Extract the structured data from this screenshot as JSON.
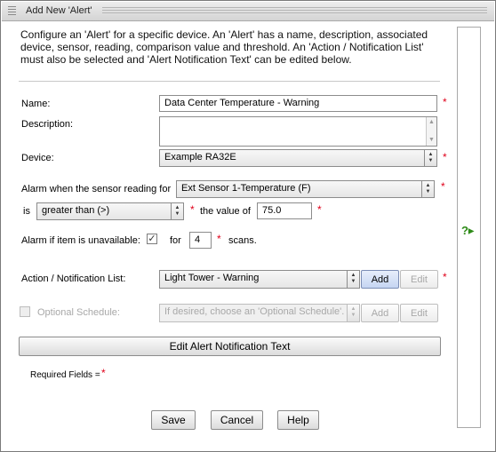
{
  "window": {
    "title": "Add New 'Alert'"
  },
  "intro_text": "Configure an 'Alert' for a specific device. An 'Alert' has a name, description, associated device, sensor, reading, comparison value and threshold. An 'Action / Notification List' must also be selected and 'Alert Notification Text' can be edited below.",
  "required_marker": "*",
  "form": {
    "name": {
      "label": "Name:",
      "value": "Data Center Temperature - Warning"
    },
    "description": {
      "label": "Description:",
      "value": ""
    },
    "device": {
      "label": "Device:",
      "value": "Example RA32E"
    },
    "alarm": {
      "label": "Alarm when the sensor reading for",
      "sensor_value": "Ext Sensor 1-Temperature (F)",
      "is_label": "is",
      "comparison_value": "greater than (>)",
      "value_of_label": "the value of",
      "threshold_value": "75.0"
    },
    "unavailable": {
      "label": "Alarm if item is unavailable:",
      "checked": true,
      "for_label": "for",
      "scans_value": "4",
      "scans_label": "scans."
    },
    "action_list": {
      "label": "Action / Notification List:",
      "value": "Light Tower - Warning",
      "add_label": "Add",
      "edit_label": "Edit"
    },
    "schedule": {
      "label": "Optional Schedule:",
      "checked": false,
      "placeholder": "If desired, choose an 'Optional Schedule'.",
      "add_label": "Add",
      "edit_label": "Edit"
    },
    "edit_notification_label": "Edit Alert Notification Text",
    "required_fields_label": "Required Fields ="
  },
  "buttons": {
    "save": "Save",
    "cancel": "Cancel",
    "help": "Help"
  },
  "help_icon": {
    "name": "help-question-icon",
    "symbol": "?"
  },
  "colors": {
    "required": "#e0001a",
    "help": "#2e8b18"
  }
}
